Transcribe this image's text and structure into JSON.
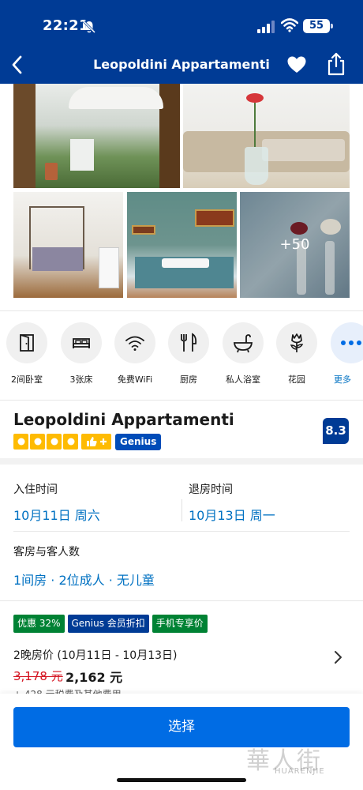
{
  "status_bar": {
    "time": "22:21",
    "battery": "55"
  },
  "nav": {
    "title": "Leopoldini Appartamenti"
  },
  "gallery": {
    "more_count": "+50"
  },
  "amenities": [
    {
      "label": "2间卧室",
      "icon": "door-icon"
    },
    {
      "label": "3张床",
      "icon": "bed-icon"
    },
    {
      "label": "免费WiFi",
      "icon": "wifi-icon"
    },
    {
      "label": "厨房",
      "icon": "fork-knife-icon"
    },
    {
      "label": "私人浴室",
      "icon": "bathtub-icon"
    },
    {
      "label": "花园",
      "icon": "flower-icon"
    },
    {
      "label": "更多",
      "icon": "more-dots-icon"
    }
  ],
  "property": {
    "name": "Leopoldini Appartamenti",
    "stars": 4,
    "genius_badge": "Genius",
    "score": "8.3"
  },
  "dates": {
    "checkin_label": "入住时间",
    "checkin_value": "10月11日 周六",
    "checkout_label": "退房时间",
    "checkout_value": "10月13日 周一"
  },
  "guests": {
    "label": "客房与客人数",
    "value": "1间房 · 2位成人 · 无儿童"
  },
  "price": {
    "tags": [
      "优惠 32%",
      "Genius 会员折扣",
      "手机专享价"
    ],
    "range": "2晚房价 (10月11日 - 10月13日)",
    "original": "3,178 元",
    "current": "2,162 元",
    "extra": "+ 428 元税费及其他费用"
  },
  "cta": {
    "select_label": "选择"
  },
  "watermark": {
    "logo": "華人街",
    "text": "HUARENJIE"
  },
  "colors": {
    "brand_blue": "#003b95",
    "button_blue": "#006ce4",
    "link_blue": "#0071c2",
    "star_yellow": "#febb02",
    "deal_green": "#008234",
    "strike_red": "#d4111e"
  }
}
